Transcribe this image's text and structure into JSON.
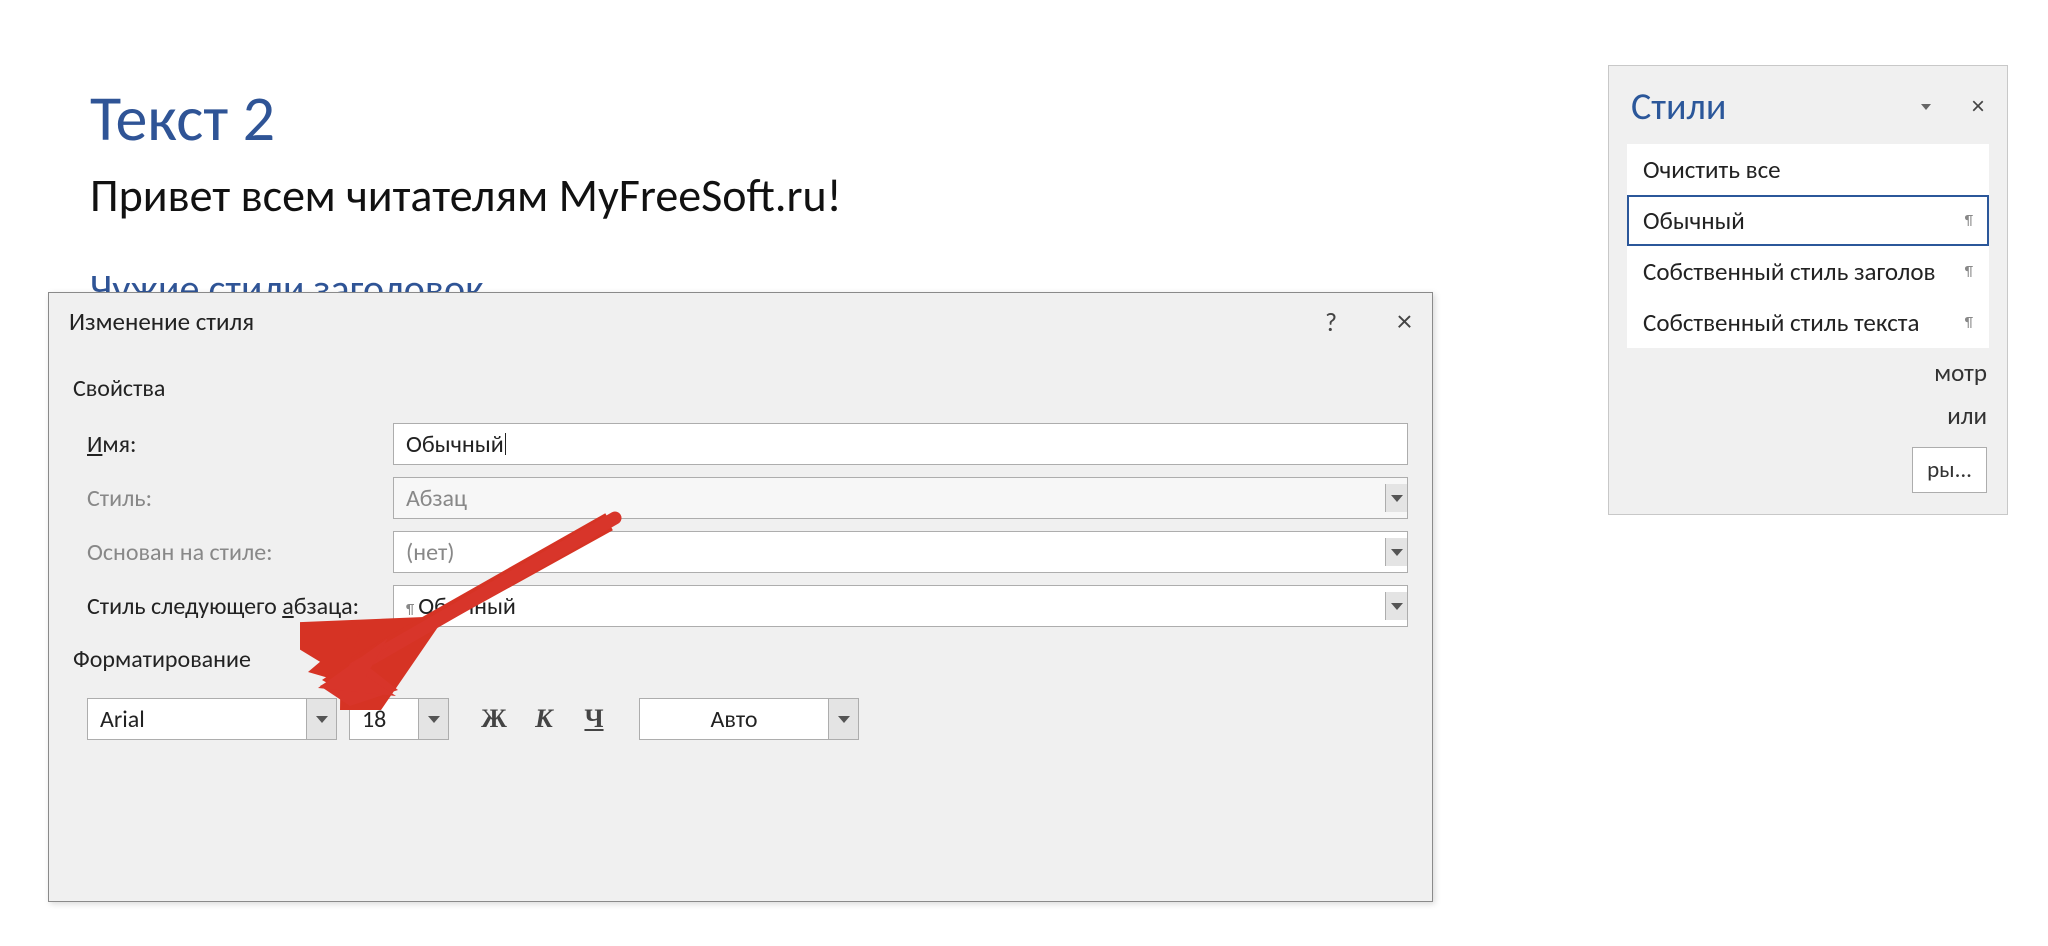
{
  "document": {
    "heading": "Текст 2",
    "body": "Привет всем читателям MyFreeSoft.ru!",
    "sub": "Чужие стили заголовок"
  },
  "styles_pane": {
    "title": "Стили",
    "items": [
      {
        "label": "Очистить все",
        "selected": false
      },
      {
        "label": "Обычный",
        "selected": true
      },
      {
        "label": "Собственный стиль заголов",
        "selected": false
      },
      {
        "label": "Собственный стиль текста",
        "selected": false
      }
    ],
    "link_preview": "мотр",
    "link_linked": "или",
    "options_button": "ры..."
  },
  "dialog": {
    "title": "Изменение стиля",
    "help": "?",
    "close": "×",
    "section_props": "Свойства",
    "name_label": "Имя:",
    "name_value": "Обычный",
    "style_label": "Стиль:",
    "style_value": "Абзац",
    "based_label": "Основан на стиле:",
    "based_value": "(нет)",
    "next_label_pre": "Стиль следующего ",
    "next_label_accel": "а",
    "next_label_post": "бзаца:",
    "next_value": "Обычный",
    "section_fmt": "Форматирование",
    "font_value": "Arial",
    "size_value": "18",
    "bold": "Ж",
    "italic": "К",
    "underline": "Ч",
    "color_value": "Авто"
  }
}
